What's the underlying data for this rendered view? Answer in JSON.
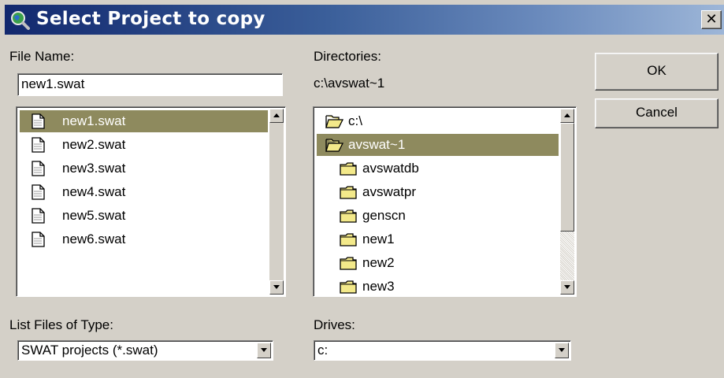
{
  "title": "Select Project to copy",
  "close_glyph": "✕",
  "file_name": {
    "label": "File Name:",
    "value": "new1.swat",
    "files": [
      {
        "name": "new1.swat",
        "selected": true
      },
      {
        "name": "new2.swat",
        "selected": false
      },
      {
        "name": "new3.swat",
        "selected": false
      },
      {
        "name": "new4.swat",
        "selected": false
      },
      {
        "name": "new5.swat",
        "selected": false
      },
      {
        "name": "new6.swat",
        "selected": false
      }
    ]
  },
  "directories": {
    "label": "Directories:",
    "current_path": "c:\\avswat~1",
    "items": [
      {
        "name": "c:\\",
        "icon": "open-folder-icon",
        "selected": false
      },
      {
        "name": "avswat~1",
        "icon": "open-folder-icon",
        "selected": true
      },
      {
        "name": "avswatdb",
        "icon": "folder-icon",
        "selected": false
      },
      {
        "name": "avswatpr",
        "icon": "folder-icon",
        "selected": false
      },
      {
        "name": "genscn",
        "icon": "folder-icon",
        "selected": false
      },
      {
        "name": "new1",
        "icon": "folder-icon",
        "selected": false
      },
      {
        "name": "new2",
        "icon": "folder-icon",
        "selected": false
      },
      {
        "name": "new3",
        "icon": "folder-icon",
        "selected": false
      }
    ]
  },
  "file_type": {
    "label": "List Files of Type:",
    "value": "SWAT projects (*.swat)"
  },
  "drives": {
    "label": "Drives:",
    "value": "c:"
  },
  "buttons": {
    "ok": "OK",
    "cancel": "Cancel"
  },
  "colors": {
    "selection": "#8e8a5e",
    "titlebar_start": "#12286e",
    "folder_yellow": "#f3e98a",
    "face": "#d4d0c8"
  }
}
